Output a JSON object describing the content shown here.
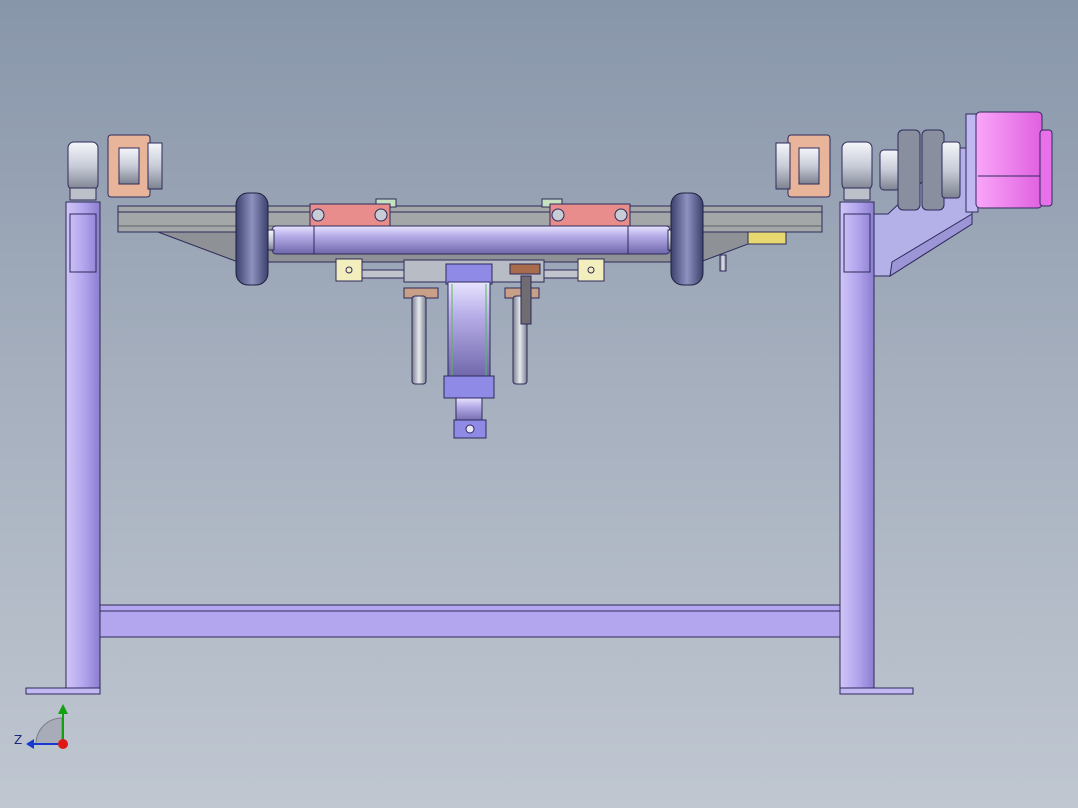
{
  "viewport": {
    "view_orientation": "front",
    "background_gradient": [
      "#8896aa",
      "#c0c7d1"
    ]
  },
  "triad": {
    "z_label": "Z",
    "colors": {
      "x": "#e01818",
      "y": "#10a010",
      "z": "#1838d0"
    }
  },
  "colors": {
    "frame": "#b4a6ee",
    "frame_dark": "#8c7ed0",
    "beam": "#a4a7a8",
    "cylinder": "#b7aee8",
    "wheel": "#6a6f9c",
    "bracket_orange": "#e8b49a",
    "clamp_red": "#e88c8c",
    "motor": "#f07cf0",
    "tab": "#f2eebe",
    "steel": "#c0c4cc"
  }
}
